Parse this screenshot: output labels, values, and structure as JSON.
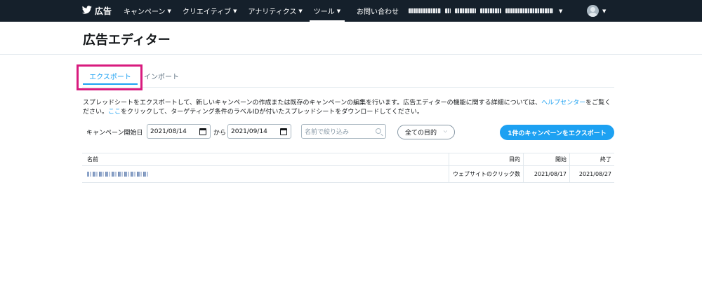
{
  "nav": {
    "brand": "広告",
    "items": [
      {
        "label": "キャンペーン"
      },
      {
        "label": "クリエイティブ"
      },
      {
        "label": "アナリティクス"
      },
      {
        "label": "ツール",
        "active": true
      }
    ],
    "contact": "お問い合わせ"
  },
  "page": {
    "title": "広告エディター"
  },
  "tabs": {
    "export": "エクスポート",
    "import": "インポート"
  },
  "description": {
    "part1": "スプレッドシートをエクスポートして、新しいキャンペーンの作成または既存のキャンペーンの編集を行います。広告エディターの機能に関する詳細については、",
    "help_link": "ヘルプセンター",
    "part2": "をご覧ください。",
    "here_link": "ここ",
    "part3": "をクリックして、ターゲティング条件のラベルIDが付いたスプレッドシートをダウンロードしてください。"
  },
  "filters": {
    "start_label": "キャンペーン開始日",
    "start_date": "2021/08/14",
    "between": "から",
    "end_date": "2021/09/14",
    "search_placeholder": "名前で絞り込み",
    "objective_select": "全ての目的",
    "export_button": "1件のキャンペーンをエクスポート"
  },
  "table": {
    "headers": {
      "name": "名前",
      "objective": "目的",
      "start": "開始",
      "end": "終了"
    },
    "rows": [
      {
        "objective": "ウェブサイトのクリック数",
        "start": "2021/08/17",
        "end": "2021/08/27"
      }
    ]
  },
  "colors": {
    "nav_bg": "#15202b",
    "accent": "#1da1f2",
    "highlight": "#d81b7e"
  }
}
